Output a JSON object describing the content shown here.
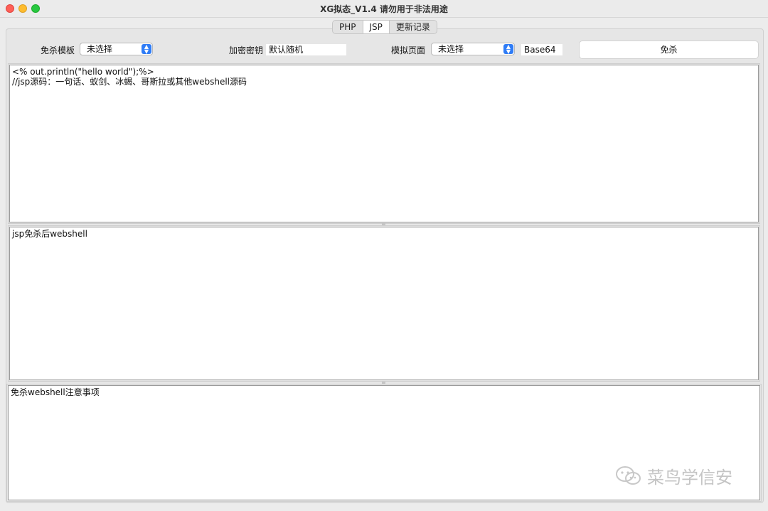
{
  "window": {
    "title": "XG拟态_V1.4 请勿用于非法用途"
  },
  "tabs": [
    {
      "label": "PHP",
      "active": false
    },
    {
      "label": "JSP",
      "active": true
    },
    {
      "label": "更新记录",
      "active": false
    }
  ],
  "toolbar": {
    "template_label": "免杀模板",
    "template_value": "未选择",
    "key_label": "加密密钥",
    "key_value": "默认随机",
    "page_label": "模拟页面",
    "page_value": "未选择",
    "encoding_value": "Base64",
    "run_button": "免杀"
  },
  "source_area": {
    "line1": "<% out.println(\"hello world\");%>",
    "line2": "//jsp源码：一句话、蚁剑、冰蝎、哥斯拉或其他webshell源码"
  },
  "output_area": {
    "text": "jsp免杀后webshell"
  },
  "notes_area": {
    "text": "免杀webshell注意事项"
  },
  "watermark": {
    "text": "菜鸟学信安",
    "icon": "wechat-icon"
  },
  "colors": {
    "close": "#fe5f57",
    "minimize": "#febc2e",
    "zoom": "#28c840",
    "select_accent": "#2f7cf6"
  }
}
